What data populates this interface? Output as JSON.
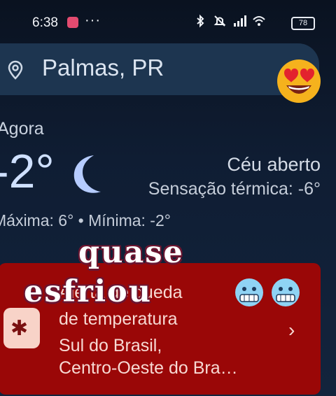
{
  "status": {
    "time": "6:38",
    "more": "···",
    "battery": "78"
  },
  "search": {
    "location": "Palmas, PR"
  },
  "current": {
    "label": "Agora",
    "temperature": "-2°",
    "condition": "Céu aberto",
    "feels_like": "Sensação térmica: -6°",
    "minmax": "Máxima: 6° • Mínima: -2°"
  },
  "alert": {
    "line1": "Alerta de queda",
    "line2": "de temperatura",
    "line3": "Sul do Brasil,",
    "line4": "Centro-Oeste do Bra…",
    "chevron": "›",
    "icon": "snow-alert-icon"
  },
  "overlay": {
    "line1": "quase",
    "line2": "esfriou"
  },
  "icons": [
    "heart-eyes-emoji",
    "moon-icon",
    "freezing-face-emoji"
  ]
}
